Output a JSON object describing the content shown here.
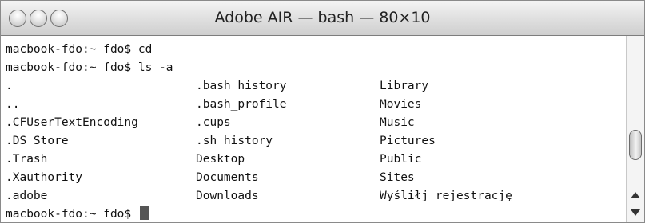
{
  "window": {
    "title": "Adobe AIR — bash — 80×10"
  },
  "terminal": {
    "line1": "macbook-fdo:~ fdo$ cd",
    "line2": "macbook-fdo:~ fdo$ ls -a",
    "listing": [
      [
        ".",
        ".bash_history",
        "Library"
      ],
      [
        "..",
        ".bash_profile",
        "Movies"
      ],
      [
        ".CFUserTextEncoding",
        ".cups",
        "Music"
      ],
      [
        ".DS_Store",
        ".sh_history",
        "Pictures"
      ],
      [
        ".Trash",
        "Desktop",
        "Public"
      ],
      [
        ".Xauthority",
        "Documents",
        "Sites"
      ],
      [
        ".adobe",
        "Downloads",
        "Wyśliłj rejestrację"
      ]
    ],
    "prompt": "macbook-fdo:~ fdo$ "
  },
  "icons": {
    "close": "close-icon",
    "minimize": "minimize-icon",
    "zoom": "zoom-icon",
    "cursor": "cursor-block-icon"
  }
}
